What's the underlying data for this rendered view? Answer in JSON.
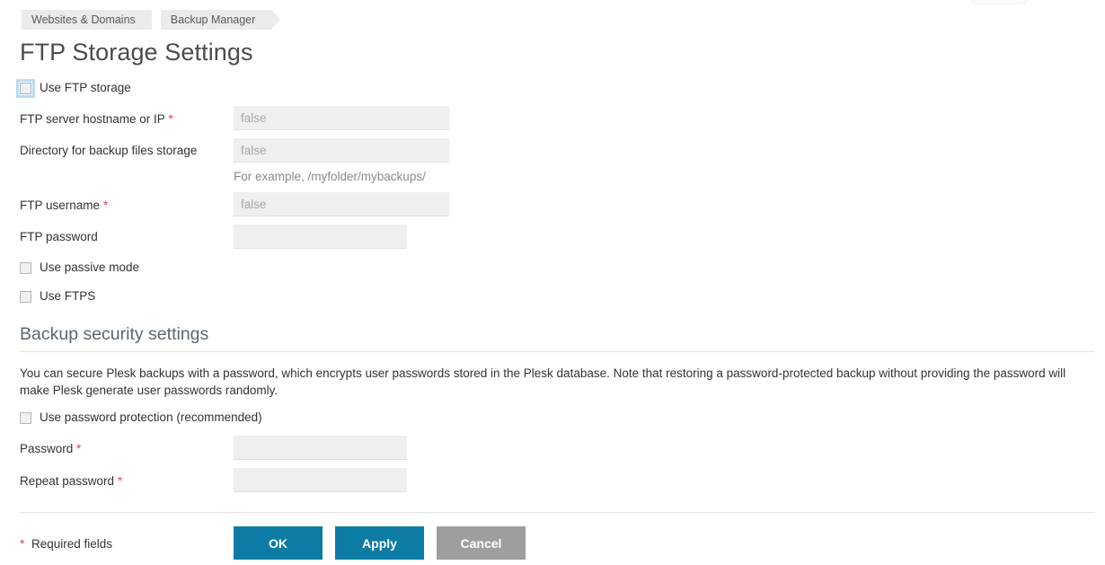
{
  "breadcrumb": {
    "items": [
      {
        "label": "Websites & Domains"
      },
      {
        "label": "Backup Manager"
      }
    ]
  },
  "page": {
    "title": "FTP Storage Settings"
  },
  "ftp_storage": {
    "use_ftp_storage": {
      "label": "Use FTP storage",
      "checked": false,
      "focused": true
    },
    "fields": [
      {
        "label": "FTP server hostname or IP",
        "required": true,
        "value": "",
        "placeholder": "false",
        "hint": ""
      },
      {
        "label": "Directory for backup files storage",
        "required": false,
        "value": "",
        "placeholder": "false",
        "hint": "For example, /myfolder/mybackups/"
      },
      {
        "label": "FTP username",
        "required": true,
        "value": "",
        "placeholder": "false",
        "hint": ""
      },
      {
        "label": "FTP password",
        "required": false,
        "value": "",
        "placeholder": "",
        "hint": ""
      }
    ],
    "use_passive_mode": {
      "label": "Use passive mode",
      "checked": false
    },
    "use_ftps": {
      "label": "Use FTPS",
      "checked": false
    }
  },
  "backup_security": {
    "heading": "Backup security settings",
    "description": "You can secure Plesk backups with a password, which encrypts user passwords stored in the Plesk database. Note that restoring a password-protected backup without providing the password will make Plesk generate user passwords randomly.",
    "use_password_protection": {
      "label": "Use password protection (recommended)",
      "checked": false
    },
    "fields": [
      {
        "label": "Password",
        "required": true,
        "value": "",
        "placeholder": ""
      },
      {
        "label": "Repeat password",
        "required": true,
        "value": "",
        "placeholder": ""
      }
    ]
  },
  "footer": {
    "required_note": "* Required fields",
    "required_marker": "*",
    "buttons": [
      {
        "label": "OK",
        "style": "primary"
      },
      {
        "label": "Apply",
        "style": "primary"
      },
      {
        "label": "Cancel",
        "style": "grey"
      }
    ]
  },
  "colors": {
    "accent_blue": "#0d7ca4",
    "cancel_grey": "#9e9e9e",
    "required_red": "#d9455f",
    "breadcrumb_bg": "#ebebeb",
    "input_bg": "#efefef",
    "heading_grey": "#5c6670",
    "title_grey": "#4c4c4c"
  }
}
